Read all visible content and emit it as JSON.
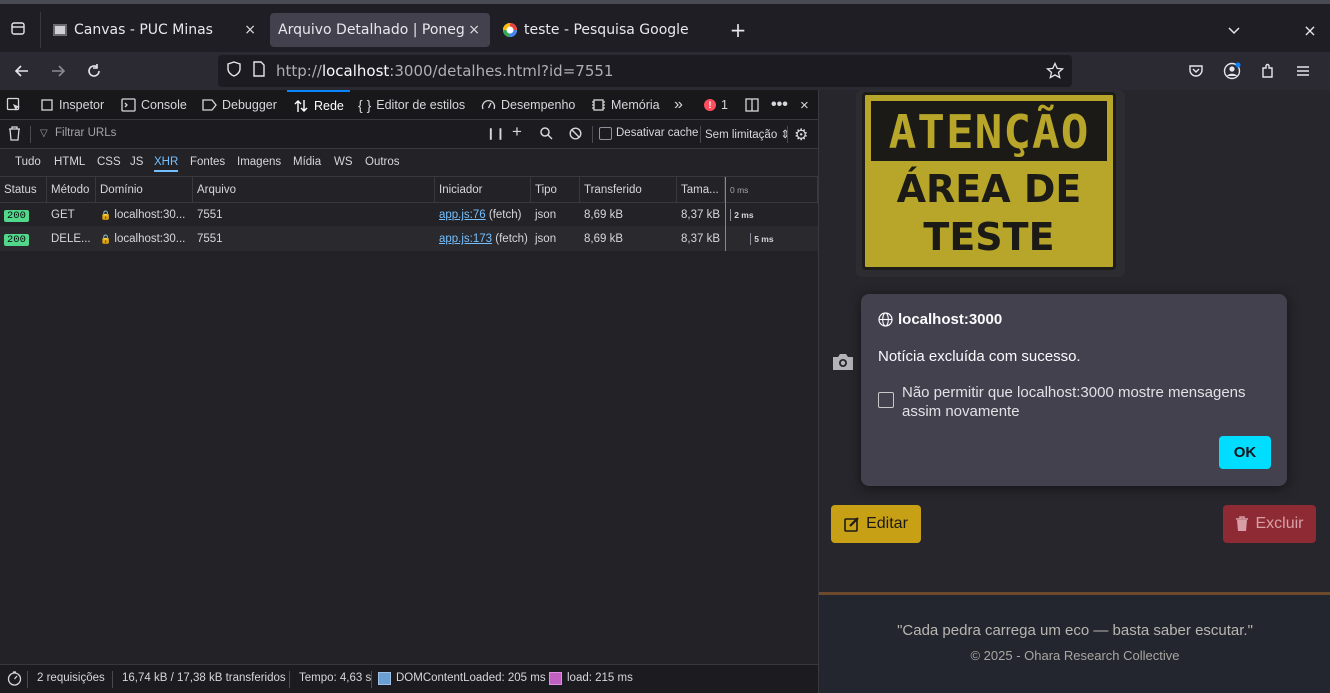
{
  "browser": {
    "tabs": [
      {
        "title": "Canvas - PUC Minas",
        "icon": "canvas-icon"
      },
      {
        "title": "Arquivo Detalhado | Poneglyph",
        "icon": "none",
        "active": true
      },
      {
        "title": "teste - Pesquisa Google",
        "icon": "google-icon"
      }
    ],
    "close_glyph": "×",
    "new_tab_glyph": "+",
    "url_prefix": "http://",
    "url_host": "localhost",
    "url_rest": ":3000/detalhes.html?id=7551"
  },
  "devtools": {
    "tabs": [
      "Inspetor",
      "Console",
      "Debugger",
      "Rede",
      "Editor de estilos",
      "Desempenho",
      "Memória"
    ],
    "error_count": "1",
    "filter_placeholder": "Filtrar URLs",
    "disable_cache": "Desativar cache",
    "throttle": "Sem limitação ⇕",
    "type_filters": [
      "Tudo",
      "HTML",
      "CSS",
      "JS",
      "XHR",
      "Fontes",
      "Imagens",
      "Mídia",
      "WS",
      "Outros"
    ],
    "columns": [
      "Status",
      "Método",
      "Domínio",
      "Arquivo",
      "Iniciador",
      "Tipo",
      "Transferido",
      "Tama...",
      "0 ms"
    ],
    "rows": [
      {
        "status": "200",
        "method": "GET",
        "domain": "localhost:30...",
        "file": "7551",
        "initiator_link": "app.js:76",
        "initiator_rest": " (fetch)",
        "type": "json",
        "transferred": "8,69 kB",
        "size": "8,37 kB",
        "time": "2 ms"
      },
      {
        "status": "200",
        "method": "DELE...",
        "domain": "localhost:30...",
        "file": "7551",
        "initiator_link": "app.js:173",
        "initiator_rest": " (fetch)",
        "type": "json",
        "transferred": "8,69 kB",
        "size": "8,37 kB",
        "time": "5 ms"
      }
    ],
    "status_bar": {
      "requests": "2 requisições",
      "transferred": "16,74 kB / 17,38 kB transferidos",
      "time": "Tempo: 4,63 s",
      "dom": "DOMContentLoaded: 205 ms",
      "load": "load: 215 ms"
    }
  },
  "page": {
    "sign_line1": "ATENÇÃO",
    "sign_line2": "ÁREA DE",
    "sign_line3": "TESTE",
    "dialog": {
      "origin": "localhost:3000",
      "message": "Notícia excluída com sucesso.",
      "checkbox_label": "Não permitir que localhost:3000 mostre mensagens assim novamente",
      "ok": "OK"
    },
    "edit_label": "Editar",
    "delete_label": "Excluir",
    "quote": "\"Cada pedra carrega um eco — basta saber escutar.\"",
    "copyright": "© 2025 - Ohara Research Collective"
  },
  "colors": {
    "accent": "#0a84ff",
    "ok_button": "#00ddff",
    "edit": "#c8a016",
    "delete": "#b02a37"
  }
}
